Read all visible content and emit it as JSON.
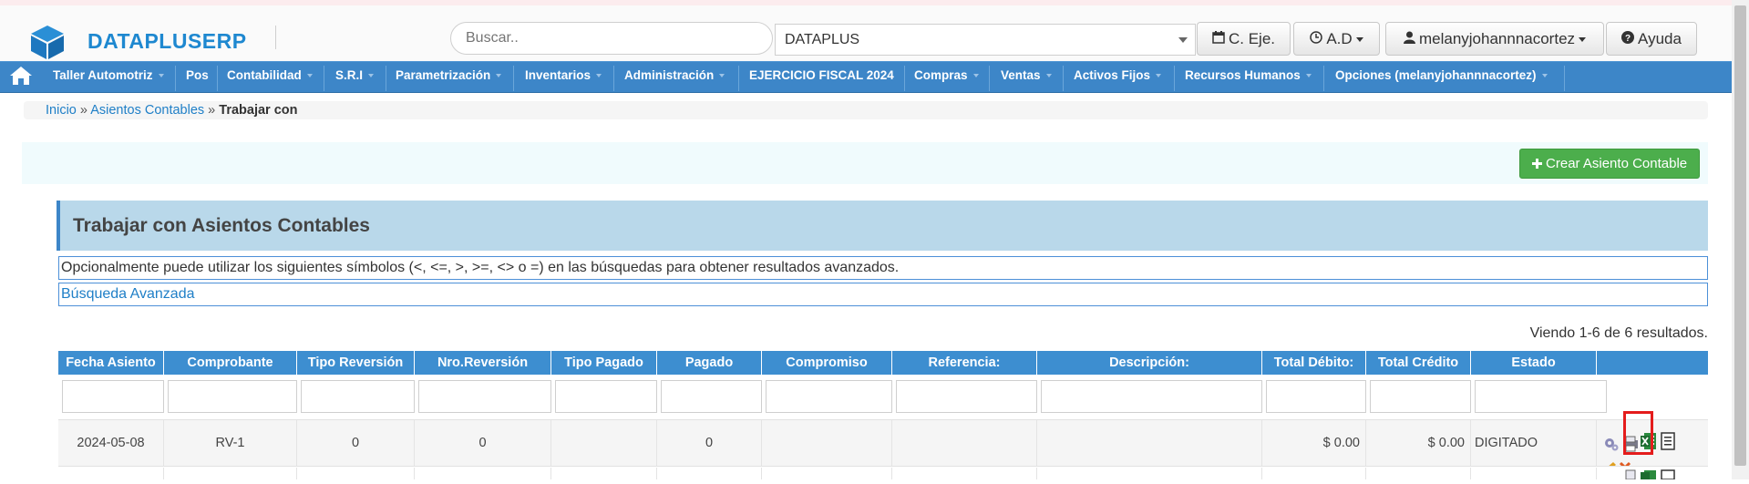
{
  "header": {
    "brand": "DATAPLUSERP",
    "search_placeholder": "Buscar..",
    "company": "DATAPLUS",
    "buttons": {
      "ejercicio": "C. Eje.",
      "ad": "A.D",
      "user": "melanyjohannnacortez",
      "help": "Ayuda"
    }
  },
  "menu": {
    "items": [
      "Taller Automotriz",
      "Pos",
      "Contabilidad",
      "S.R.I",
      "Parametrización",
      "Inventarios",
      "Administración",
      "EJERCICIO FISCAL 2024",
      "Compras",
      "Ventas",
      "Activos Fijos",
      "Recursos Humanos",
      "Opciones (melanyjohannnacortez)"
    ]
  },
  "breadcrumb": {
    "home": "Inicio",
    "section": "Asientos Contables",
    "current": "Trabajar con",
    "separator": "»"
  },
  "actions": {
    "create": "Crear Asiento Contable"
  },
  "panel": {
    "title": "Trabajar con Asientos Contables",
    "info": "Opcionalmente puede utilizar los siguientes símbolos (<, <=, >, >=, <> o =) en las búsquedas para obtener resultados avanzados.",
    "advanced": "Búsqueda Avanzada",
    "summary": "Viendo 1-6 de 6 resultados."
  },
  "table": {
    "columns": [
      "Fecha Asiento",
      "Comprobante",
      "Tipo Reversión",
      "Nro.Reversión",
      "Tipo Pagado",
      "Pagado",
      "Compromiso",
      "Referencia:",
      "Descripción:",
      "Total Débito:",
      "Total Crédito",
      "Estado",
      ""
    ],
    "rows": [
      {
        "fecha": "2024-05-08",
        "comprobante": "RV-1",
        "tipo_reversion": "0",
        "nro_reversion": "0",
        "tipo_pagado": "",
        "pagado": "0",
        "compromiso": "",
        "referencia": "",
        "descripcion": "",
        "total_debito": "$ 0.00",
        "total_credito": "$ 0.00",
        "estado": "DIGITADO"
      }
    ]
  },
  "colors": {
    "brand": "#1e88d0",
    "menubar": "#3d86c8",
    "table_header": "#3d8ed0",
    "create_button": "#4cae4c",
    "highlight": "#e41c1c"
  },
  "icons": {
    "logo": "cube-icon",
    "calendar": "calendar-icon",
    "clock": "clock-icon",
    "user": "user-icon",
    "help": "question-circle-icon",
    "home": "home-icon",
    "plus": "plus-icon"
  }
}
